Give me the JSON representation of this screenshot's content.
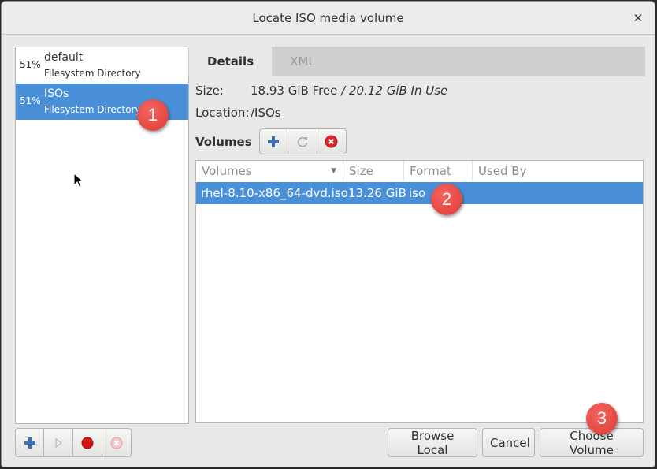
{
  "window": {
    "title": "Locate ISO media volume"
  },
  "pools": [
    {
      "percent": "51%",
      "name": "default",
      "type": "Filesystem Directory"
    },
    {
      "percent": "51%",
      "name": "ISOs",
      "type": "Filesystem Directory"
    }
  ],
  "tabs": [
    {
      "label": "Details"
    },
    {
      "label": "XML"
    }
  ],
  "details": {
    "size_label": "Size:",
    "size_free": "18.93 GiB Free",
    "size_sep": " / ",
    "size_in_use": "20.12 GiB In Use",
    "location_label": "Location:",
    "location_value": "/ISOs"
  },
  "volumes": {
    "label": "Volumes",
    "columns": [
      "Volumes",
      "Size",
      "Format",
      "Used By"
    ],
    "rows": [
      {
        "name": "rhel-8.10-x86_64-dvd.iso",
        "size": "13.26 GiB",
        "format": "iso",
        "used_by": ""
      }
    ]
  },
  "buttons": {
    "browse_local": "Browse Local",
    "cancel": "Cancel",
    "choose_volume": "Choose Volume"
  },
  "markers": [
    "1",
    "2",
    "3"
  ],
  "colors": {
    "selection": "#4a90d9",
    "marker": "#e6463f",
    "add_icon": "#3b6fb6",
    "stop_icon": "#d01616"
  }
}
